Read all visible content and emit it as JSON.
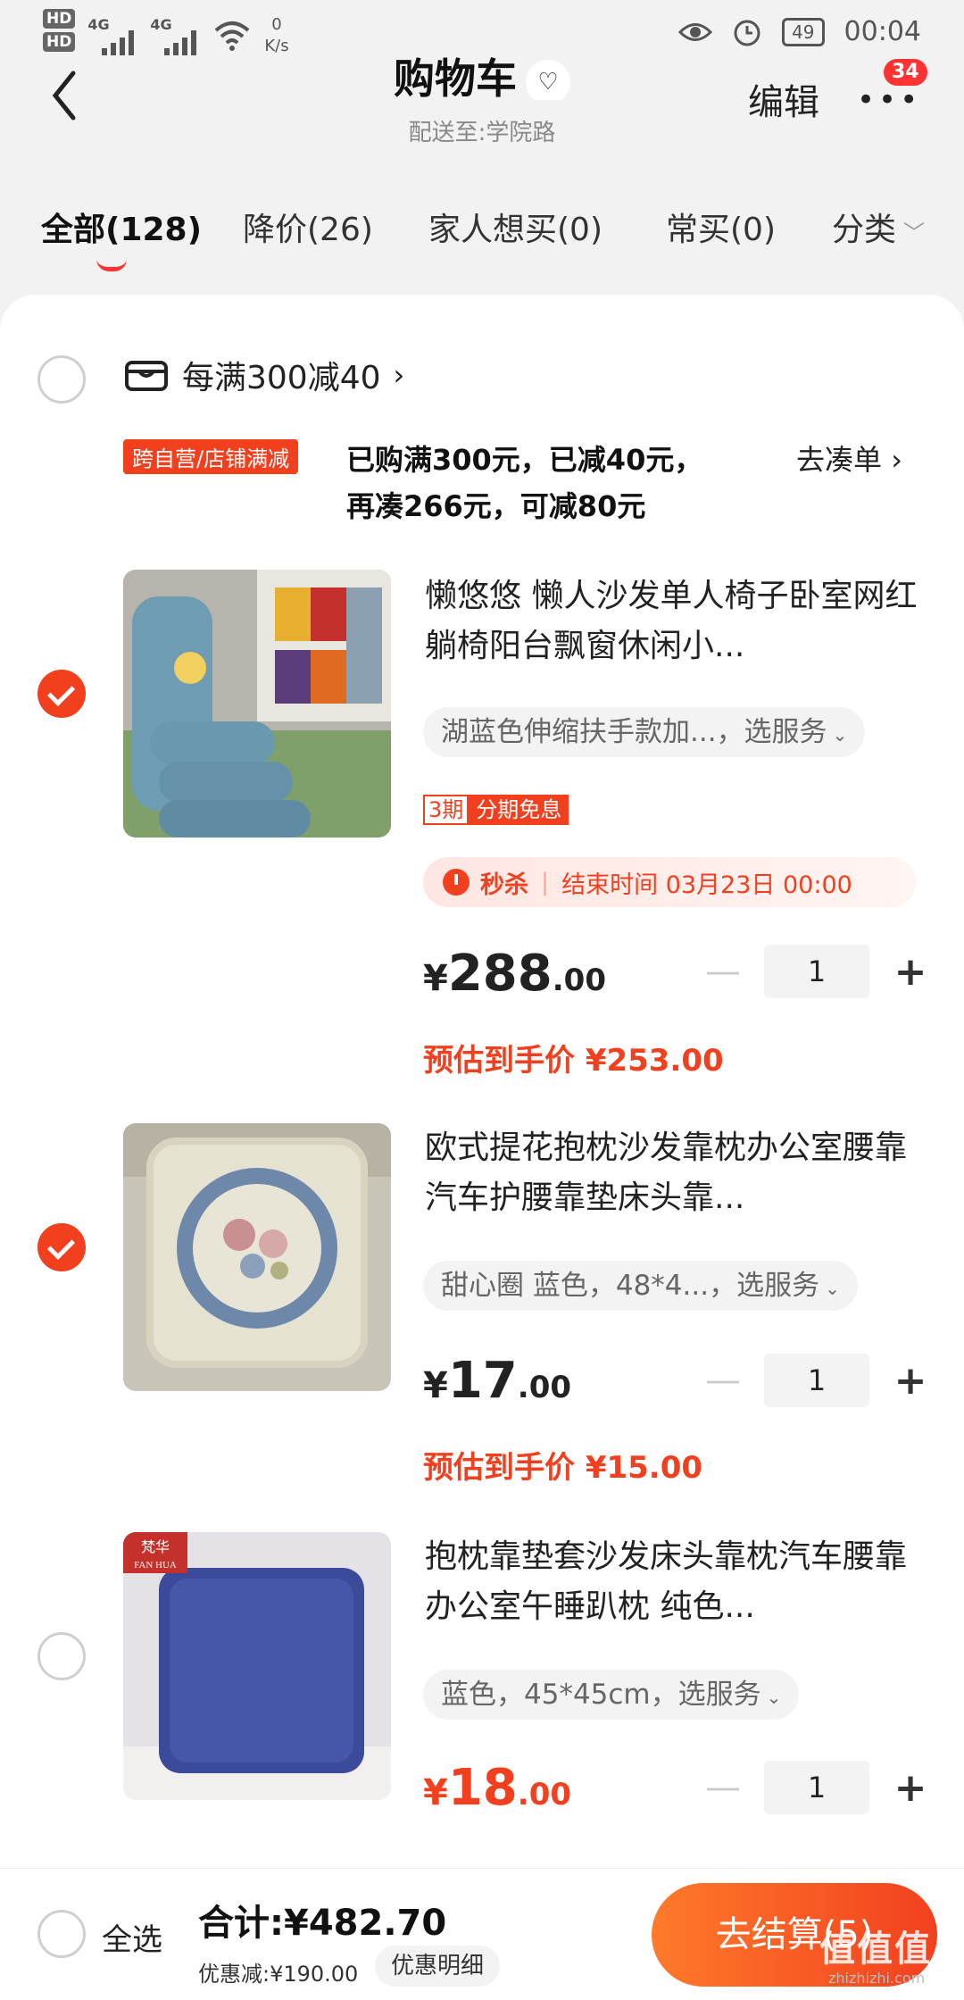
{
  "status_bar": {
    "hd1": "HD",
    "hd2": "HD",
    "net1": "4G",
    "net2": "4G",
    "speed_value": "0",
    "speed_unit": "K/s",
    "battery": "49",
    "time": "00:04"
  },
  "header": {
    "title": "购物车",
    "subtitle": "配送至:学院路",
    "edit_label": "编辑",
    "more_badge": "34"
  },
  "tabs": [
    {
      "label": "全部(128)"
    },
    {
      "label": "降价(26)"
    },
    {
      "label": "家人想买(0)"
    },
    {
      "label": "常买(0)"
    },
    {
      "label": "分类"
    }
  ],
  "shop": {
    "promo_title": "每满300减40",
    "promo_tag": "跨自营/店铺满减",
    "promo_line1": "已购满300元，已减40元，",
    "promo_line2": "再凑266元，可减80元",
    "promo_action": "去凑单"
  },
  "items": [
    {
      "title": "懒悠悠 懒人沙发单人椅子卧室网红躺椅阳台飘窗休闲小...",
      "spec": "湖蓝色伸缩扶手款加...，选服务",
      "installment_a": "3期",
      "installment_b": "分期免息",
      "flash_label": "秒杀",
      "flash_time": "结束时间 03月23日 00:00",
      "price_currency": "¥",
      "price_int": "288",
      "price_dec": ".00",
      "qty": "1",
      "estimate": "预估到手价 ¥253.00",
      "checked": true
    },
    {
      "title": "欧式提花抱枕沙发靠枕办公室腰靠汽车护腰靠垫床头靠...",
      "spec": "甜心圈  蓝色，48*4...，选服务",
      "price_currency": "¥",
      "price_int": "17",
      "price_dec": ".00",
      "qty": "1",
      "estimate": "预估到手价 ¥15.00",
      "checked": true
    },
    {
      "title": "抱枕靠垫套沙发床头靠枕汽车腰靠办公室午睡趴枕 纯色...",
      "spec": "蓝色，45*45cm，选服务",
      "brand_cn": "梵华",
      "brand_en": "FAN HUA",
      "price_currency": "¥",
      "price_int": "18",
      "price_dec": ".00",
      "qty": "1",
      "checked": false
    }
  ],
  "bottom": {
    "select_all": "全选",
    "total": "合计:¥482.70",
    "discount": "优惠减:¥190.00",
    "detail": "优惠明细",
    "checkout": "去结算(5)"
  },
  "watermark": {
    "main": "值值值",
    "sub": "zhizhizhi.com"
  },
  "colors": {
    "accent": "#f2401f",
    "background": "#f2f2f2"
  }
}
